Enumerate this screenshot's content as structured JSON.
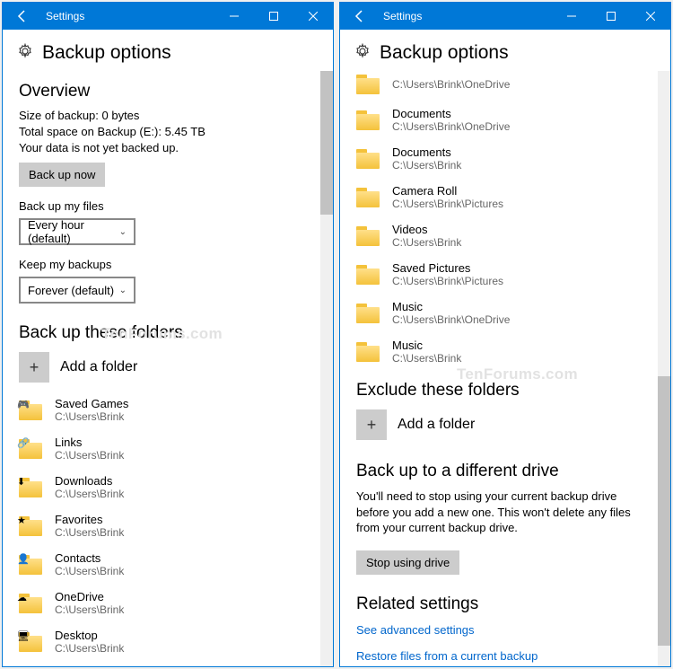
{
  "titlebar_title": "Settings",
  "page_title": "Backup options",
  "watermark": "TenForums.com",
  "left": {
    "overview_heading": "Overview",
    "size_line": "Size of backup: 0 bytes",
    "space_line": "Total space on Backup (E:): 5.45 TB",
    "status_line": "Your data is not yet backed up.",
    "backup_now_btn": "Back up now",
    "freq_label": "Back up my files",
    "freq_value": "Every hour (default)",
    "keep_label": "Keep my backups",
    "keep_value": "Forever (default)",
    "backup_folders_heading": "Back up these folders",
    "add_folder_label": "Add a folder",
    "folders": [
      {
        "name": "Saved Games",
        "path": "C:\\Users\\Brink",
        "overlay": "🎮"
      },
      {
        "name": "Links",
        "path": "C:\\Users\\Brink",
        "overlay": "🔗"
      },
      {
        "name": "Downloads",
        "path": "C:\\Users\\Brink",
        "overlay": "⬇"
      },
      {
        "name": "Favorites",
        "path": "C:\\Users\\Brink",
        "overlay": "★"
      },
      {
        "name": "Contacts",
        "path": "C:\\Users\\Brink",
        "overlay": "👤"
      },
      {
        "name": "OneDrive",
        "path": "C:\\Users\\Brink",
        "overlay": "☁"
      },
      {
        "name": "Desktop",
        "path": "C:\\Users\\Brink",
        "overlay": "🖥"
      }
    ]
  },
  "right": {
    "top_folders": [
      {
        "name": "",
        "path": "C:\\Users\\Brink\\OneDrive"
      },
      {
        "name": "Documents",
        "path": "C:\\Users\\Brink\\OneDrive"
      },
      {
        "name": "Documents",
        "path": "C:\\Users\\Brink"
      },
      {
        "name": "Camera Roll",
        "path": "C:\\Users\\Brink\\Pictures"
      },
      {
        "name": "Videos",
        "path": "C:\\Users\\Brink"
      },
      {
        "name": "Saved Pictures",
        "path": "C:\\Users\\Brink\\Pictures"
      },
      {
        "name": "Music",
        "path": "C:\\Users\\Brink\\OneDrive"
      },
      {
        "name": "Music",
        "path": "C:\\Users\\Brink"
      }
    ],
    "exclude_heading": "Exclude these folders",
    "add_folder_label": "Add a folder",
    "diff_drive_heading": "Back up to a different drive",
    "diff_drive_text": "You'll need to stop using your current backup drive before you add a new one. This won't delete any files from your current backup drive.",
    "stop_btn": "Stop using drive",
    "related_heading": "Related settings",
    "link_advanced": "See advanced settings",
    "link_restore": "Restore files from a current backup"
  }
}
